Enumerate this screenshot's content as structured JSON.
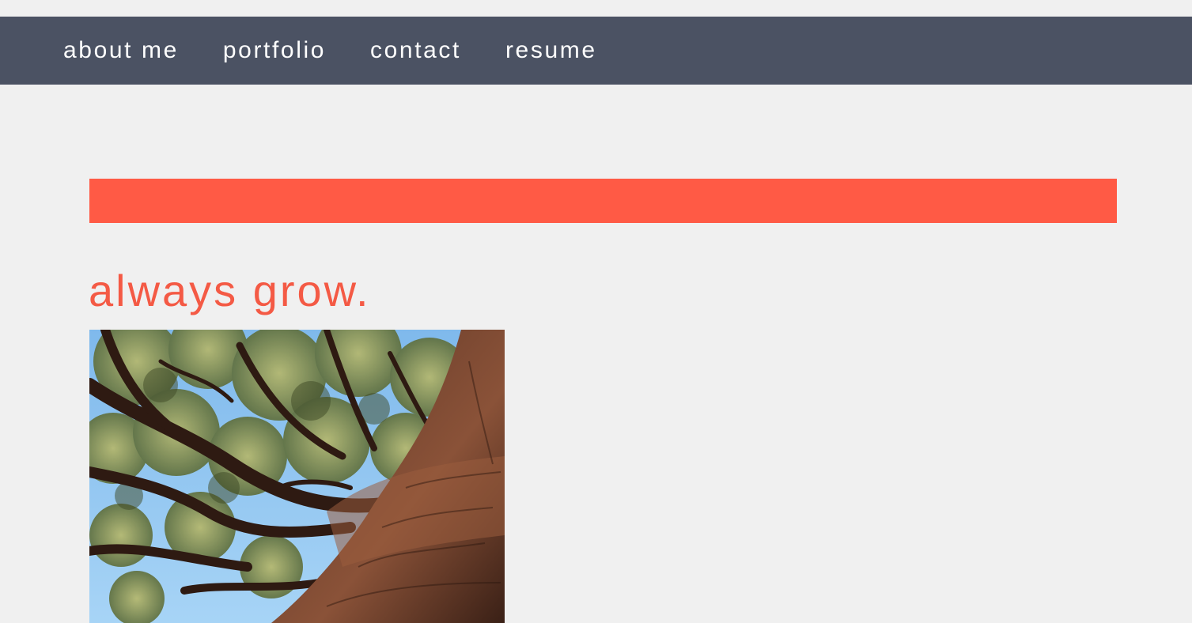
{
  "nav": {
    "items": [
      {
        "label": "about me"
      },
      {
        "label": "portfolio"
      },
      {
        "label": "contact"
      },
      {
        "label": "resume"
      }
    ]
  },
  "hero": {
    "tagline": "always grow."
  },
  "photo": {
    "subject": "tree-canopy-photo"
  },
  "colors": {
    "navbar_bg": "#4b5263",
    "page_bg": "#f0f0f0",
    "accent": "#ff5a45",
    "tagline": "#f45a45",
    "nav_text": "#ffffff"
  }
}
